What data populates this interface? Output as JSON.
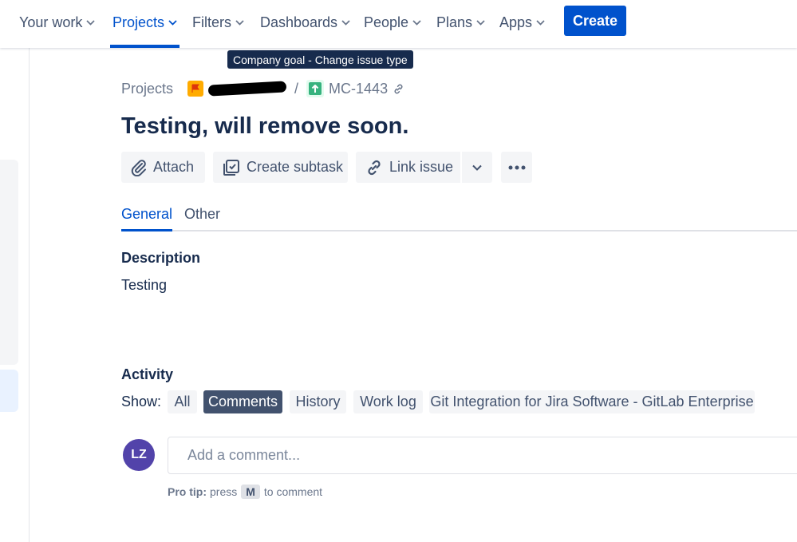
{
  "nav": {
    "items": [
      {
        "label": "Your work"
      },
      {
        "label": "Projects"
      },
      {
        "label": "Filters"
      },
      {
        "label": "Dashboards"
      },
      {
        "label": "People"
      },
      {
        "label": "Plans"
      },
      {
        "label": "Apps"
      }
    ],
    "active": "Projects",
    "create_label": "Create"
  },
  "tooltip": "Company goal - Change issue type",
  "breadcrumb": {
    "projects_label": "Projects",
    "separator": "/",
    "issue_key": "MC-1443"
  },
  "issue": {
    "title": "Testing, will remove soon."
  },
  "actions": {
    "attach": "Attach",
    "create_subtask": "Create subtask",
    "link_issue": "Link issue"
  },
  "tabs": [
    {
      "label": "General"
    },
    {
      "label": "Other"
    }
  ],
  "description": {
    "heading": "Description",
    "text": "Testing"
  },
  "activity": {
    "heading": "Activity",
    "show_label": "Show:",
    "filters": [
      {
        "label": "All"
      },
      {
        "label": "Comments"
      },
      {
        "label": "History"
      },
      {
        "label": "Work log"
      },
      {
        "label": "Git Integration for Jira Software - GitLab Enterprise"
      }
    ],
    "active_filter": "Comments"
  },
  "comment": {
    "avatar_initials": "LZ",
    "placeholder": "Add a comment...",
    "protip_label": "Pro tip:",
    "protip_press": "press",
    "protip_key": "M",
    "protip_suffix": "to comment"
  },
  "colors": {
    "brand_blue": "#0052cc",
    "avatar": "#5243aa",
    "issue_type_green": "#36b37e",
    "project_icon": "#ffab00"
  }
}
